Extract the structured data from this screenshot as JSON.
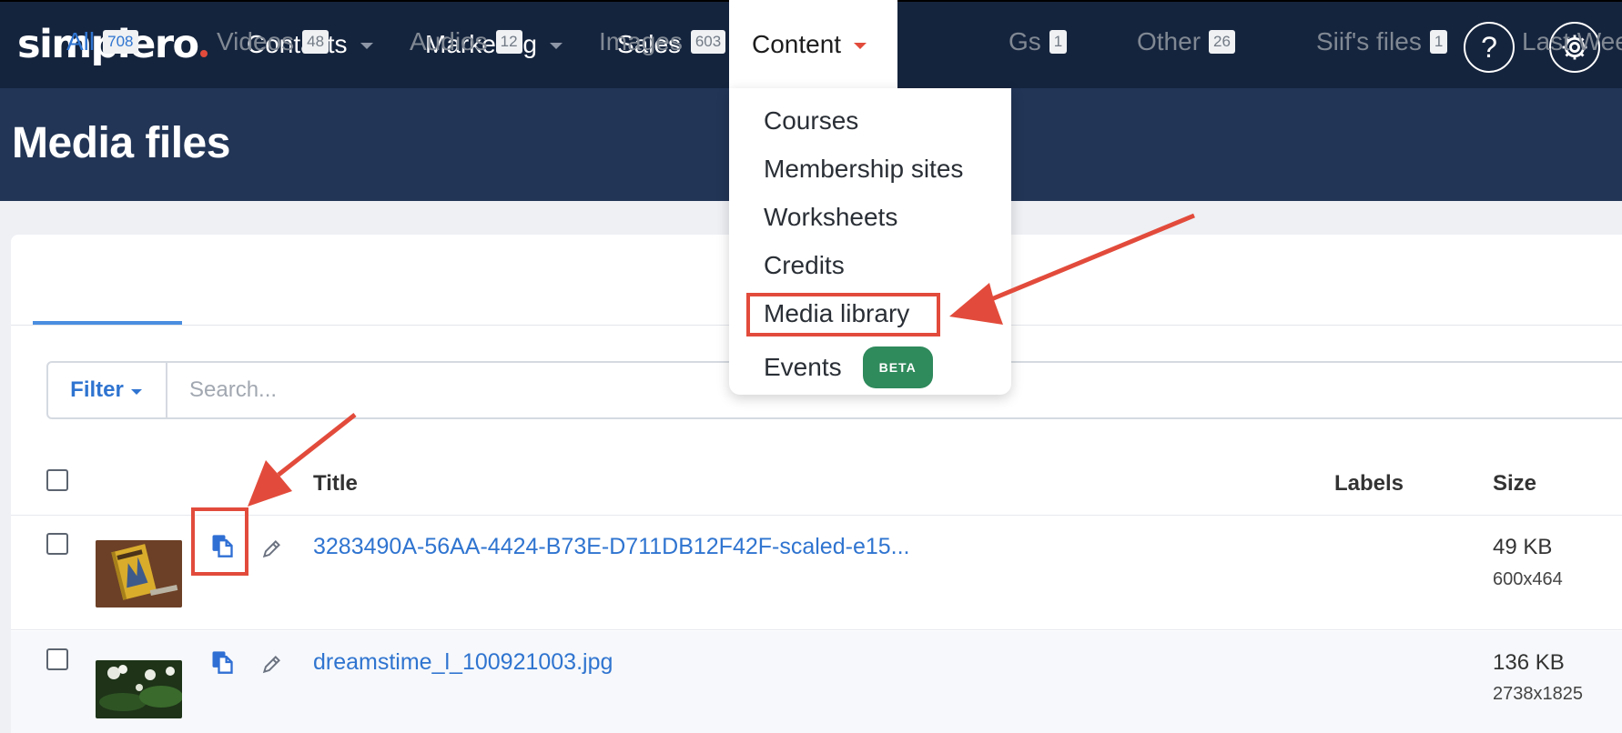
{
  "app": {
    "logo_text": "simplero",
    "logo_dot_color": "#e24b3b"
  },
  "nav": {
    "items": [
      {
        "label": "Contacts"
      },
      {
        "label": "Marketing"
      },
      {
        "label": "Sales"
      },
      {
        "label": "Content"
      }
    ],
    "help_label": "?"
  },
  "page": {
    "title": "Media files"
  },
  "tabs": [
    {
      "label": "All",
      "count": "708"
    },
    {
      "label": "Videos",
      "count": "48"
    },
    {
      "label": "Audios",
      "count": "12"
    },
    {
      "label": "Images",
      "count": "603"
    },
    {
      "label": "Gs",
      "count": "1"
    },
    {
      "label": "Other",
      "count": "26"
    },
    {
      "label": "Siif's files",
      "count": "1"
    },
    {
      "label": "Last Wee"
    }
  ],
  "filter": {
    "label": "Filter",
    "search_placeholder": "Search..."
  },
  "table": {
    "columns": {
      "title": "Title",
      "labels": "Labels",
      "size": "Size"
    },
    "rows": [
      {
        "title": "3283490A-56AA-4424-B73E-D711DB12F42F-scaled-e15...",
        "size": "49 KB",
        "dimensions": "600x464"
      },
      {
        "title": "dreamstime_l_100921003.jpg",
        "size": "136 KB",
        "dimensions": "2738x1825"
      }
    ]
  },
  "content_menu": {
    "items": [
      {
        "label": "Courses"
      },
      {
        "label": "Membership sites"
      },
      {
        "label": "Worksheets"
      },
      {
        "label": "Credits"
      },
      {
        "label": "Media library"
      },
      {
        "label": "Events",
        "badge": "BETA"
      }
    ]
  },
  "colors": {
    "nav_bg": "#15243d",
    "header_bg": "#223556",
    "link": "#2f74d0",
    "highlight": "#e24b3b",
    "beta_badge": "#2f8a5c"
  }
}
